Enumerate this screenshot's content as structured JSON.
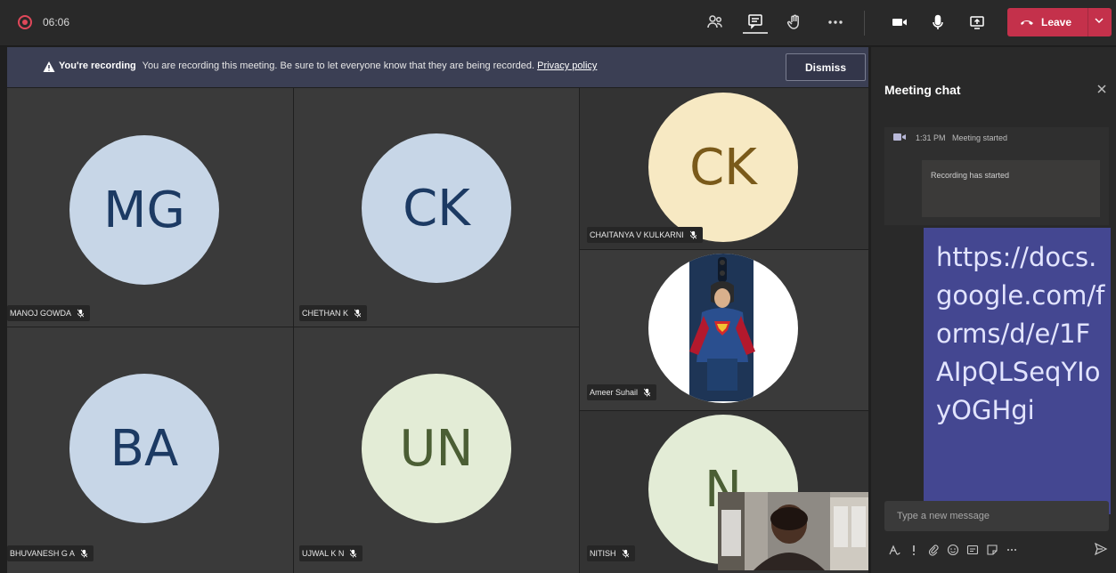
{
  "topbar": {
    "timer": "06:06",
    "leave_label": "Leave"
  },
  "banner": {
    "bold": "You're recording",
    "message": "You are recording this meeting. Be sure to let everyone know that they are being recorded.",
    "link": "Privacy policy",
    "dismiss_label": "Dismiss"
  },
  "participants": [
    {
      "initials": "MG",
      "name": "MANOJ GOWDA"
    },
    {
      "initials": "CK",
      "name": "CHETHAN K"
    },
    {
      "initials": "CK",
      "name": "CHAITANYA V KULKARNI"
    },
    {
      "initials": "",
      "name": "Ameer Suhail"
    },
    {
      "initials": "BA",
      "name": "BHUVANESH G A"
    },
    {
      "initials": "UN",
      "name": "UJWAL K N"
    },
    {
      "initials": "N",
      "name": "NITISH"
    }
  ],
  "chat": {
    "title": "Meeting chat",
    "event_time": "1:31 PM",
    "event_label": "Meeting started",
    "recording_label": "Recording has started",
    "message": "https://docs.google.com/forms/d/e/1FAIpQLSeqYIoyOGHgi",
    "compose_placeholder": "Type a new message"
  },
  "colors": {
    "leave": "#c4314b",
    "banner": "#3b3f54",
    "message_bubble": "#444791",
    "recording": "#e0485a"
  }
}
